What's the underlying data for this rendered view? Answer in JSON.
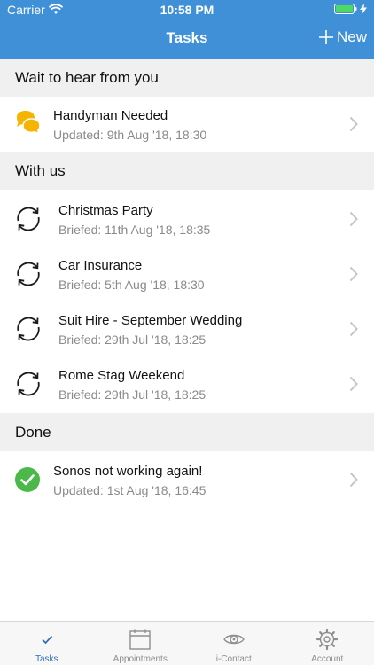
{
  "status_bar": {
    "carrier": "Carrier",
    "time": "10:58 PM"
  },
  "nav": {
    "title": "Tasks",
    "new_label": "New"
  },
  "sections": [
    {
      "title": "Wait to hear from you",
      "items": [
        {
          "title": "Handyman Needed",
          "subtitle": "Updated: 9th Aug '18, 18:30",
          "icon": "chat-bubbles-icon"
        }
      ]
    },
    {
      "title": "With us",
      "items": [
        {
          "title": "Christmas Party",
          "subtitle": "Briefed: 11th Aug '18, 18:35",
          "icon": "sync-icon"
        },
        {
          "title": "Car Insurance",
          "subtitle": "Briefed: 5th Aug '18, 18:30",
          "icon": "sync-icon"
        },
        {
          "title": "Suit Hire - September Wedding",
          "subtitle": "Briefed: 29th Jul '18, 18:25",
          "icon": "sync-icon"
        },
        {
          "title": "Rome Stag Weekend",
          "subtitle": "Briefed: 29th Jul '18, 18:25",
          "icon": "sync-icon"
        }
      ]
    },
    {
      "title": "Done",
      "items": [
        {
          "title": "Sonos not working again!",
          "subtitle": "Updated: 1st Aug '18, 16:45",
          "icon": "check-circle-icon"
        }
      ]
    }
  ],
  "tabs": [
    {
      "label": "Tasks",
      "icon": "checkmark-icon",
      "active": true
    },
    {
      "label": "Appointments",
      "icon": "calendar-icon",
      "active": false
    },
    {
      "label": "i-Contact",
      "icon": "eye-icon",
      "active": false
    },
    {
      "label": "Account",
      "icon": "gear-icon",
      "active": false
    }
  ],
  "colors": {
    "header": "#3f90d6",
    "active_tab": "#2f6fb6",
    "chat_icon": "#f5b400",
    "done_icon": "#4cb84a"
  }
}
